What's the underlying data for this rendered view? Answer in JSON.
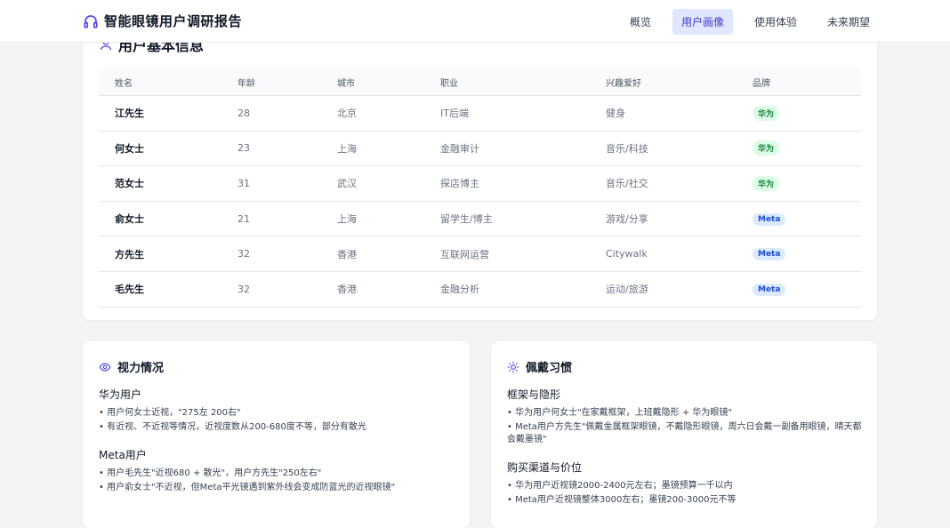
{
  "header": {
    "title": "智能眼镜用户调研报告",
    "nav": [
      {
        "label": "概览"
      },
      {
        "label": "用户画像"
      },
      {
        "label": "使用体验"
      },
      {
        "label": "未来期望"
      }
    ],
    "active_index": 1
  },
  "colors": {
    "accent": "#4f46e5",
    "huawei_badge_bg": "#dcfce7",
    "meta_badge_bg": "#dbeafe"
  },
  "users_section": {
    "title": "用户基本信息",
    "icon": "user-icon",
    "columns": [
      "姓名",
      "年龄",
      "城市",
      "职业",
      "兴趣爱好",
      "品牌"
    ],
    "rows": [
      {
        "name": "江先生",
        "age": "28",
        "city": "北京",
        "job": "IT后端",
        "hobby": "健身",
        "brand": "华为"
      },
      {
        "name": "何女士",
        "age": "23",
        "city": "上海",
        "job": "金融审计",
        "hobby": "音乐/科技",
        "brand": "华为"
      },
      {
        "name": "范女士",
        "age": "31",
        "city": "武汉",
        "job": "探店博主",
        "hobby": "音乐/社交",
        "brand": "华为"
      },
      {
        "name": "俞女士",
        "age": "21",
        "city": "上海",
        "job": "留学生/博主",
        "hobby": "游戏/分享",
        "brand": "Meta"
      },
      {
        "name": "方先生",
        "age": "32",
        "city": "香港",
        "job": "互联网运营",
        "hobby": "Citywalk",
        "brand": "Meta"
      },
      {
        "name": "毛先生",
        "age": "32",
        "city": "香港",
        "job": "金融分析",
        "hobby": "运动/旅游",
        "brand": "Meta"
      }
    ]
  },
  "vision": {
    "title": "视力情况",
    "icon": "eye-icon",
    "groups": [
      {
        "title": "华为用户",
        "bullets": [
          "• 用户何女士近视，\"275左 200右\"",
          "• 有近视、不近视等情况，近视度数从200-680度不等，部分有散光"
        ]
      },
      {
        "title": "Meta用户",
        "bullets": [
          "• 用户毛先生\"近视680 + 散光\"，用户方先生\"250左右\"",
          "• 用户俞女士\"不近视，但Meta平光镜遇到紫外线会变成防蓝光的近视眼镜\""
        ]
      }
    ]
  },
  "habits": {
    "title": "佩戴习惯",
    "icon": "sun-icon",
    "groups": [
      {
        "title": "框架与隐形",
        "bullets": [
          "• 华为用户何女士\"在家戴框架，上班戴隐形 + 华为眼镜\"",
          "• Meta用户方先生\"佩戴金属框架眼镜，不戴隐形眼镜，周六日会戴一副备用眼镜，晴天都会戴墨镜\""
        ]
      },
      {
        "title": "购买渠道与价位",
        "bullets": [
          "• 华为用户近视镜2000-2400元左右；墨镜预算一千以内",
          "• Meta用户近视镜整体3000左右；墨镜200-3000元不等"
        ]
      }
    ]
  }
}
